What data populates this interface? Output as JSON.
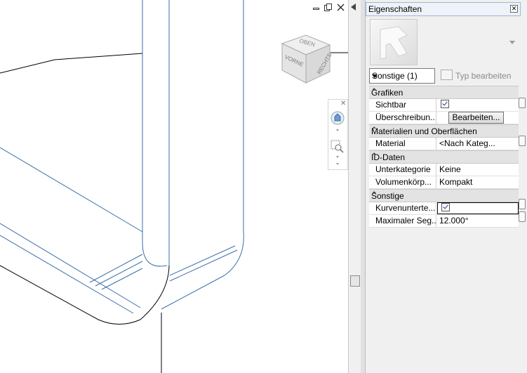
{
  "viewport": {
    "viewcube": {
      "top_face": "OBEN",
      "front_face": "VORNE",
      "right_face": "RECHTS"
    },
    "window_controls": [
      "restore-icon",
      "tile-icon",
      "close-icon"
    ],
    "navbar": [
      "steering-wheel-icon",
      "zoom-icon"
    ]
  },
  "properties": {
    "title": "Eigenschaften",
    "type_selector": "Sonstige (1)",
    "edit_type_label": "Typ bearbeiten",
    "sections": [
      {
        "name": "Grafiken",
        "rows": [
          {
            "label": "Sichtbar",
            "value": "",
            "checkbox": true
          },
          {
            "label": "Überschreibun...",
            "value": "",
            "button": "Bearbeiten..."
          }
        ]
      },
      {
        "name": "Materialien und Oberflächen",
        "rows": [
          {
            "label": "Material",
            "value": "<Nach Kateg..."
          }
        ]
      },
      {
        "name": "ID-Daten",
        "rows": [
          {
            "label": "Unterkategorie",
            "value": "Keine"
          },
          {
            "label": "Volumenkörp...",
            "value": "Kompakt"
          }
        ]
      },
      {
        "name": "Sonstige",
        "rows": [
          {
            "label": "Kurvenunterte...",
            "value": "",
            "checkbox": true
          },
          {
            "label": "Maximaler Seg...",
            "value": "12.000°"
          }
        ]
      }
    ]
  },
  "colors": {
    "edge_blue": "#3a6ea8",
    "edge_black": "#000000"
  }
}
